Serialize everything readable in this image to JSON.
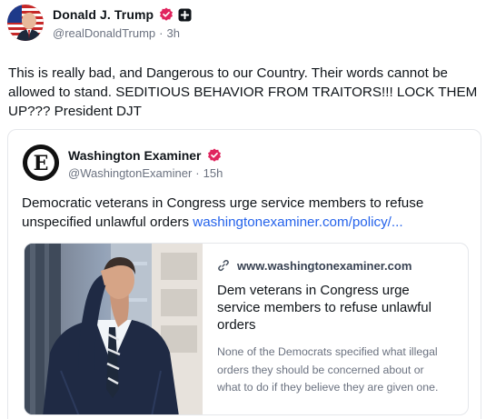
{
  "post": {
    "author_name": "Donald J. Trump",
    "handle": "@realDonaldTrump",
    "separator": "·",
    "time": "3h",
    "text": "This is really bad, and Dangerous to our Country. Their words cannot be allowed to stand. SEDITIOUS BEHAVIOR FROM TRAITORS!!! LOCK THEM UP??? President DJT",
    "icons": {
      "avatar": "avatar-flag-portrait",
      "verified": "verified-badge-icon",
      "plus": "plus-box-icon"
    }
  },
  "quote": {
    "author_name": "Washington Examiner",
    "handle": "@WashingtonExaminer",
    "separator": "·",
    "time": "15h",
    "text": "Democratic veterans in Congress urge service members to refuse unspecified unlawful orders ",
    "link_text": "washingtonexaminer.com/policy/...",
    "card": {
      "domain": "www.washingtonexaminer.com",
      "title": "Dem veterans in Congress urge service members to refuse unlawful orders",
      "description": "None of the Democrats specified what illegal orders they should be concerned about or what to do if they believe they are given one."
    }
  },
  "colors": {
    "verified": "#e0245e",
    "link": "#2563eb",
    "muted": "#6b7280",
    "text": "#0f1419",
    "border": "#e5e7eb"
  }
}
